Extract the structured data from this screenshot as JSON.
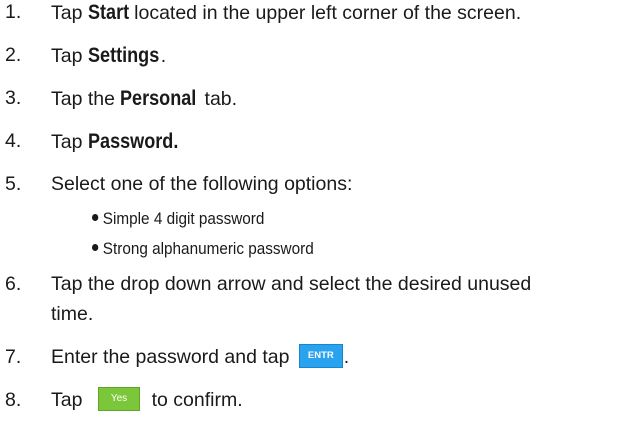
{
  "steps": [
    {
      "num": "1.",
      "before": "Tap ",
      "keyword": "Start",
      "after": " located in the upper left corner of the screen."
    },
    {
      "num": "2.",
      "before": "Tap ",
      "keyword": "Settings",
      "after": "."
    },
    {
      "num": "3.",
      "before": "Tap the ",
      "keyword": "Personal",
      "after": " tab."
    },
    {
      "num": "4.",
      "before": "Tap ",
      "keyword": "Password.",
      "after": ""
    },
    {
      "num": "5.",
      "text": "Select one of the following options:"
    },
    {
      "num": "6.",
      "line1": "Tap the drop down arrow and select the desired unused",
      "line2": "time."
    },
    {
      "num": "7.",
      "before": "Enter the password and tap ",
      "button": "ENTR",
      "after": "."
    },
    {
      "num": "8.",
      "before": "Tap ",
      "button": "Yes",
      "after": " to confirm."
    }
  ],
  "options": [
    "Simple 4 digit password",
    "Strong alphanumeric password"
  ],
  "colors": {
    "entr_button": "#29a3f0",
    "yes_button": "#7cc63a"
  }
}
